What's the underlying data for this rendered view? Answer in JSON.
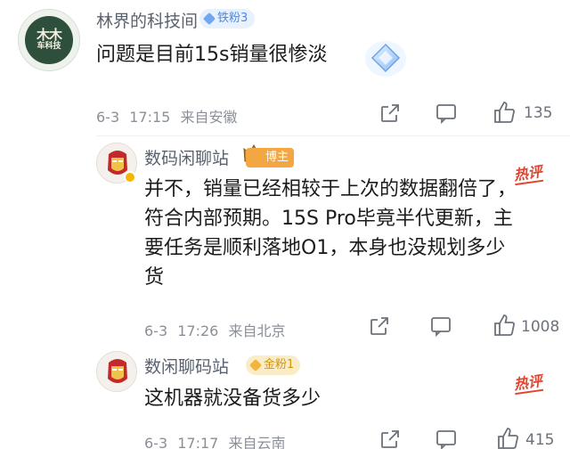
{
  "comments": [
    {
      "username": "林界的科技间",
      "badge": "铁粉3",
      "avatar_text_top": "木木",
      "avatar_text_bottom": "车科技",
      "text": "问题是目前15s销量很惨淡",
      "date": "6-3",
      "time": "17:15",
      "location": "来自安徽",
      "likes": "135"
    }
  ],
  "replies": [
    {
      "username": "数码闲聊站",
      "badge": "博主",
      "tag": "热评",
      "text_lines": [
        "并不，销量已经相较于上次的数据翻倍了，",
        "符合内部预期。15S Pro毕竟半代更新，主",
        "要任务是顺利落地O1，本身也没规划多少",
        "货"
      ],
      "date": "6-3",
      "time": "17:26",
      "location": "来自北京",
      "likes": "1008"
    },
    {
      "username": "数闲聊码站",
      "badge": "金粉1",
      "tag": "热评",
      "text": "这机器就没备货多少",
      "date": "6-3",
      "time": "17:17",
      "location": "来自云南",
      "likes": "415"
    }
  ],
  "icons": {
    "share": "share-icon",
    "comment": "comment-icon",
    "like": "thumbs-up-icon",
    "sticker": "diamond-sticker-icon"
  },
  "colors": {
    "username": "#5a6270",
    "meta": "#8a8f98",
    "hot": "#e2442f",
    "fan_badge": "#4a8ae0"
  }
}
